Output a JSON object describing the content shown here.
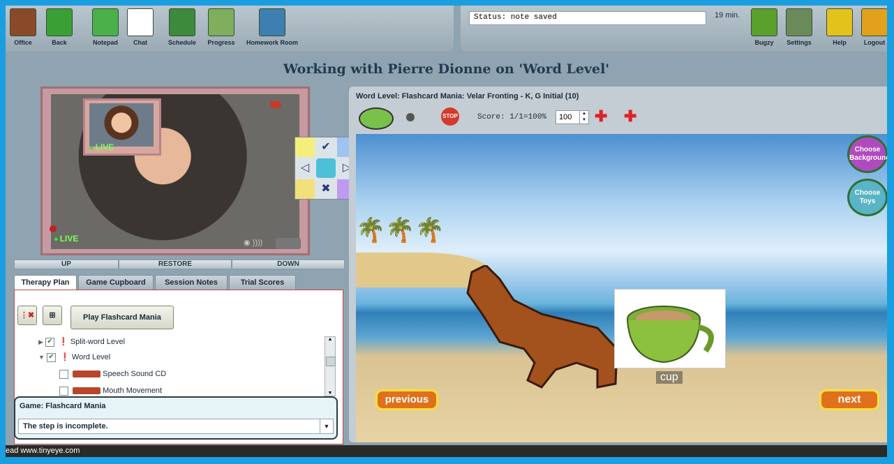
{
  "toolbar": {
    "items": [
      {
        "label": "Office",
        "color": "#8a4a2a"
      },
      {
        "label": "Back",
        "color": "#3aa036"
      },
      {
        "label": "Notepad",
        "color": "#4cb04a"
      },
      {
        "label": "Chat",
        "color": "#ffffff"
      },
      {
        "label": "Schedule",
        "color": "#3c8a3c"
      },
      {
        "label": "Progress",
        "color": "#7fae5c"
      },
      {
        "label": "Homework Room",
        "color": "#3d7fb0"
      }
    ],
    "status": "Status: note saved",
    "timer": "19 min.",
    "right_items": [
      {
        "label": "Bugzy",
        "color": "#5aa02c"
      },
      {
        "label": "Settings",
        "color": "#6b8a5a"
      },
      {
        "label": "Help",
        "color": "#e3c21b"
      },
      {
        "label": "Logout",
        "color": "#e0a21b"
      }
    ]
  },
  "page_title": "Working with Pierre Dionne on 'Word Level'",
  "video": {
    "live_label": "LIVE",
    "restore_bar": {
      "up": "UP",
      "restore": "RESTORE",
      "down": "DOWN"
    }
  },
  "tabs": [
    "Therapy Plan",
    "Game Cupboard",
    "Session Notes",
    "Trial Scores"
  ],
  "therapy_plan": {
    "play_button": "Play Flashcard Mania",
    "tree": [
      {
        "label": "Split-word Level",
        "checked": true
      },
      {
        "label": "Word Level",
        "checked": true
      },
      {
        "label": "Speech Sound CD",
        "checked": false
      },
      {
        "label": "Mouth Movement",
        "checked": false
      }
    ]
  },
  "game_box": {
    "title": "Game: Flashcard Mania",
    "step_status": "The step is incomplete."
  },
  "game": {
    "title": "Word Level: Flashcard Mania: Velar Fronting - K, G Initial (10)",
    "score": "Score: 1/1=100%",
    "zoom_value": "100",
    "choose_background": "Choose Background",
    "choose_toys": "Choose Toys",
    "card_word": "cup",
    "previous": "previous",
    "next": "next"
  },
  "footer": "ead www.tinyeye.com"
}
